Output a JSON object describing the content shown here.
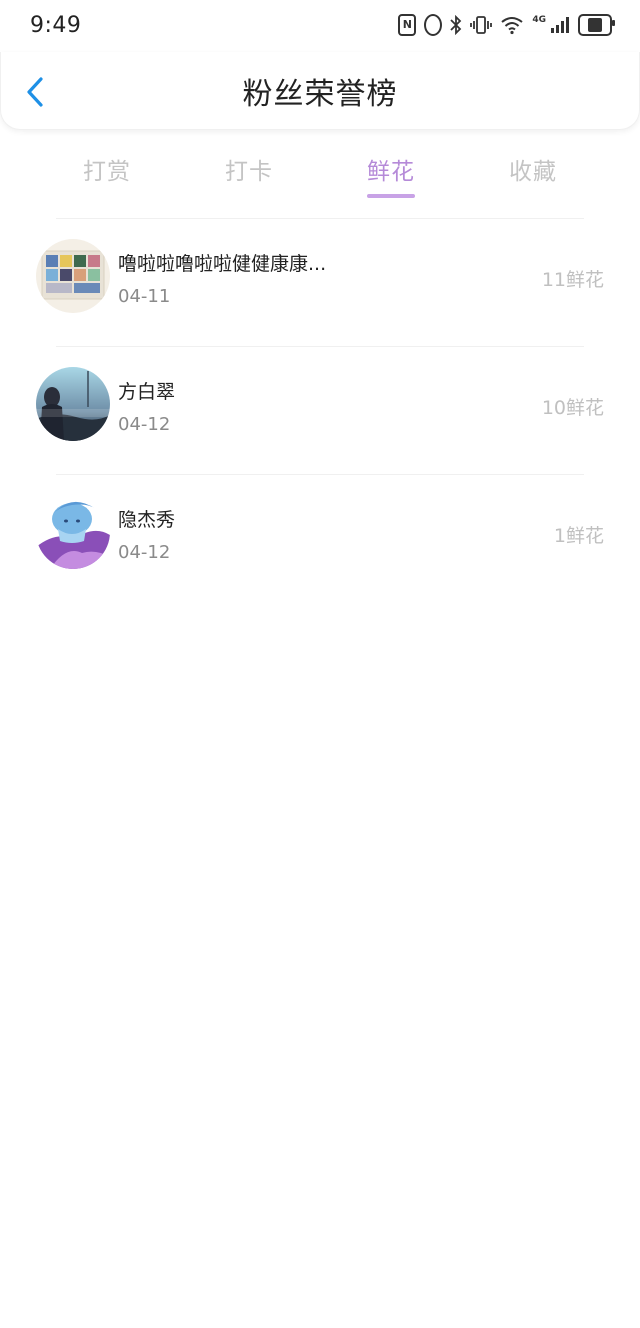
{
  "status_bar": {
    "time": "9:49",
    "icons": [
      "nfc-icon",
      "alarm-icon",
      "bluetooth-icon",
      "vibrate-icon",
      "wifi-icon",
      "4g-signal-icon",
      "battery-icon"
    ],
    "network_label": "4G",
    "battery_level": 0.55
  },
  "header": {
    "title": "粉丝荣誉榜",
    "back_icon": "chevron-left-icon",
    "accent_color": "#1e90e6"
  },
  "tabs": [
    {
      "label": "打赏",
      "active": false
    },
    {
      "label": "打卡",
      "active": false
    },
    {
      "label": "鲜花",
      "active": true
    },
    {
      "label": "收藏",
      "active": false
    }
  ],
  "tab_active_color": "#b58ad8",
  "list": [
    {
      "name": "噜啦啦噜啦啦健健康康...",
      "date": "04-11",
      "count": "11鲜花",
      "avatar": "collage-avatar"
    },
    {
      "name": "方白翠",
      "date": "04-12",
      "count": "10鲜花",
      "avatar": "photo-avatar"
    },
    {
      "name": "隐杰秀",
      "date": "04-12",
      "count": "1鲜花",
      "avatar": "cartoon-avatar"
    }
  ]
}
